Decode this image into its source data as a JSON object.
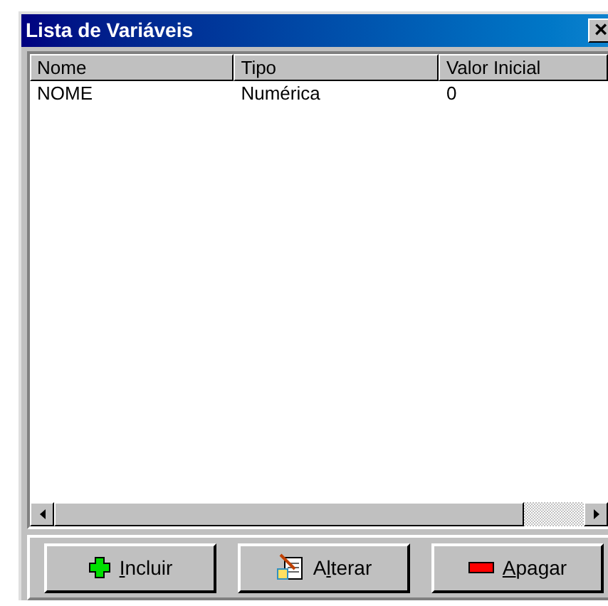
{
  "window": {
    "title": "Lista de Variáveis",
    "close": "×"
  },
  "table": {
    "columns": [
      "Nome",
      "Tipo",
      "Valor Inicial"
    ],
    "rows": [
      [
        "NOME",
        "Numérica",
        "0"
      ]
    ]
  },
  "buttons": [
    {
      "kind": "add",
      "key": "I",
      "after": "ncluir"
    },
    {
      "kind": "edit",
      "before": "A",
      "key": "l",
      "after": "terar"
    },
    {
      "kind": "delete",
      "key": "A",
      "after": "pagar"
    }
  ]
}
